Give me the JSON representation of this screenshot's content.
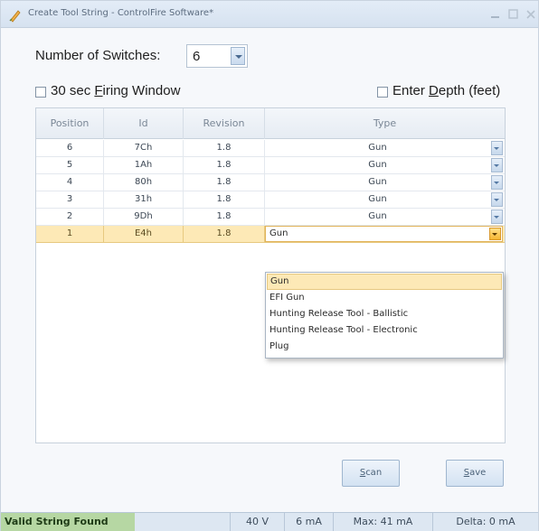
{
  "window": {
    "title": "Create Tool String - ControlFire Software*"
  },
  "switches": {
    "label": "Number of Switches:",
    "value": "6"
  },
  "options": {
    "firing_window_pre": "30 sec ",
    "firing_window_accel": "F",
    "firing_window_post": "iring Window",
    "enter_depth_pre": "Enter ",
    "enter_depth_accel": "D",
    "enter_depth_post": "epth (feet)"
  },
  "grid": {
    "headers": [
      "Position",
      "Id",
      "Revision",
      "Type"
    ],
    "rows": [
      {
        "position": "6",
        "id": "7Ch",
        "revision": "1.8",
        "type": "Gun"
      },
      {
        "position": "5",
        "id": "1Ah",
        "revision": "1.8",
        "type": "Gun"
      },
      {
        "position": "4",
        "id": "80h",
        "revision": "1.8",
        "type": "Gun"
      },
      {
        "position": "3",
        "id": "31h",
        "revision": "1.8",
        "type": "Gun"
      },
      {
        "position": "2",
        "id": "9Dh",
        "revision": "1.8",
        "type": "Gun"
      },
      {
        "position": "1",
        "id": "E4h",
        "revision": "1.8",
        "type": "Gun"
      }
    ],
    "selected_row": "1"
  },
  "type_dropdown": {
    "options": [
      "Gun",
      "EFI Gun",
      "Hunting Release Tool - Ballistic",
      "Hunting Release Tool - Electronic",
      "Plug"
    ],
    "highlighted": "Gun"
  },
  "buttons": {
    "scan_accel": "S",
    "scan_rest": "can",
    "save_accel": "S",
    "save_rest": "ave"
  },
  "status": {
    "message": "Valid String Found",
    "voltage": "40 V",
    "current": "6 mA",
    "max": "Max: 41 mA",
    "delta": "Delta: 0 mA"
  },
  "colors": {
    "selection": "#fde9b6",
    "status_ok": "#b6d7a3",
    "accent": "#f5b632"
  }
}
